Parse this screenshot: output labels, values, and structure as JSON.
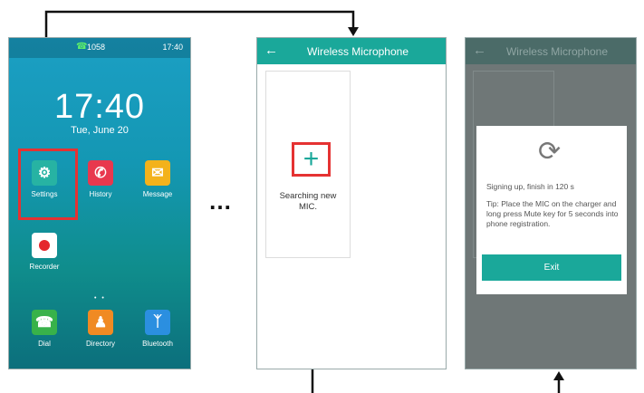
{
  "screen1": {
    "status": {
      "extension": "1058",
      "time": "17:40"
    },
    "clock": "17:40",
    "date": "Tue, June 20",
    "apps": [
      {
        "label": "Settings",
        "icon": "gear-icon",
        "color": "#27b3a3"
      },
      {
        "label": "History",
        "icon": "missed-call-icon",
        "color": "#e8384e"
      },
      {
        "label": "Message",
        "icon": "envelope-icon",
        "color": "#f3b21b"
      },
      {
        "label": "Recorder",
        "icon": "record-icon",
        "color": "#ffffff"
      }
    ],
    "dock": [
      {
        "label": "Dial",
        "icon": "phone-icon",
        "color": "#38b24a"
      },
      {
        "label": "Directory",
        "icon": "contact-icon",
        "color": "#f08a23"
      },
      {
        "label": "Bluetooth",
        "icon": "bluetooth-icon",
        "color": "#2b8fe0"
      }
    ]
  },
  "ellipsis": "…",
  "screen2": {
    "title": "Wireless Microphone",
    "add_symbol": "+",
    "search_text": "Searching new MIC."
  },
  "screen3": {
    "title": "Wireless Microphone",
    "dialog": {
      "status": "Signing up, finish in 120 s",
      "tip": "Tip: Place the MIC on the charger and long press Mute key for 5 seconds into phone registration.",
      "exit_label": "Exit"
    }
  },
  "colors": {
    "accent": "#1aa89a",
    "highlight": "#e53232"
  }
}
